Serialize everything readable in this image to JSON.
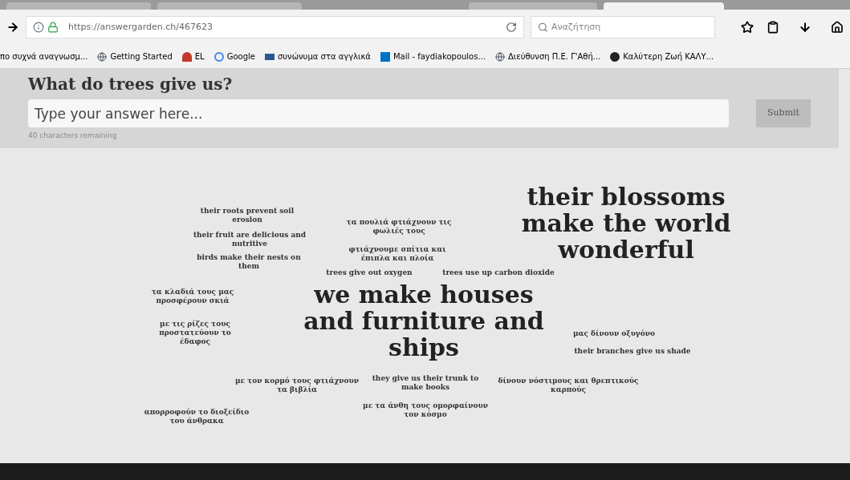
{
  "browser": {
    "tabs": [
      {
        "selected": false
      },
      {
        "selected": false
      },
      {
        "selected": false
      },
      {
        "selected": true
      }
    ],
    "url": "https://answergarden.ch/467623",
    "search": {
      "placeholder": "Αναζήτηση"
    },
    "bookmarks": [
      {
        "label": "πο συχνά αναγνωσμ..."
      },
      {
        "label": "Getting Started"
      },
      {
        "label": "EL"
      },
      {
        "label": "Google"
      },
      {
        "label": "συνώνυμα στα αγγλικά"
      },
      {
        "label": "Mail - faydiakopoulos..."
      },
      {
        "label": "Διεύθυνση Π.Ε. Γ'Αθή..."
      },
      {
        "label": "Καλύτερη Ζωή  ΚΑΛΥ..."
      }
    ]
  },
  "page": {
    "question": "What do trees give us?",
    "answer": {
      "placeholder": "Type your answer here..."
    },
    "submit": "Submit",
    "remaining": "40 characters remaining",
    "answers": [
      {
        "text": "their roots prevent soil erosion",
        "kind": "small"
      },
      {
        "text": "their fruit are delicious and nutritive",
        "kind": "small"
      },
      {
        "text": "birds make their nests on them",
        "kind": "small"
      },
      {
        "text": "τα πουλιά φτιάχνουν τις φωλιές τους",
        "kind": "small"
      },
      {
        "text": "φτιάχνουμε σπίτια και έπιπλα και πλοία",
        "kind": "small"
      },
      {
        "text": "trees give out oxygen",
        "kind": "small"
      },
      {
        "text": "trees use up carbon dioxide",
        "kind": "small"
      },
      {
        "text": "their blossoms make the world wonderful",
        "kind": "large"
      },
      {
        "text": "τα κλαδιά τους μας προσφέρουν σκιά",
        "kind": "small"
      },
      {
        "text": "με τις ρίζες τους προστατεύουν το έδαφος",
        "kind": "small"
      },
      {
        "text": "we make houses and furniture and ships",
        "kind": "large"
      },
      {
        "text": "μας δίνουν οξυγόνο",
        "kind": "small"
      },
      {
        "text": "their branches give us shade",
        "kind": "small"
      },
      {
        "text": "με τον κορμό τους φτιάχνουν τα βιβλία",
        "kind": "small"
      },
      {
        "text": "they give us their trunk to make books",
        "kind": "small"
      },
      {
        "text": "με τα άνθη τους ομορφαίνουν τον κόσμο",
        "kind": "small"
      },
      {
        "text": "δίνουν νόστιμους και θρεπτικούς καρπούς",
        "kind": "small"
      },
      {
        "text": "απορροφούν το διοξείδιο του άνθρακα",
        "kind": "small"
      }
    ]
  }
}
